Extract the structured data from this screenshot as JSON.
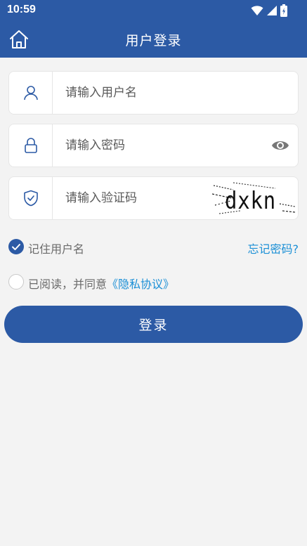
{
  "status_bar": {
    "time": "10:59"
  },
  "header": {
    "title": "用户登录",
    "home_icon": "home-icon"
  },
  "form": {
    "username": {
      "placeholder": "请输入用户名",
      "value": ""
    },
    "password": {
      "placeholder": "请输入密码",
      "value": ""
    },
    "captcha": {
      "placeholder": "请输入验证码",
      "value": "",
      "image_text": "dxkn"
    },
    "remember_label": "记住用户名",
    "remember_checked": true,
    "forgot_label": "忘记密码?",
    "agree_text": "已阅读，并同意",
    "privacy_link": "《隐私协议》",
    "agree_checked": false,
    "login_label": "登录"
  },
  "colors": {
    "primary": "#2c5aa5",
    "link": "#1a8fd6",
    "background": "#f3f3f3"
  }
}
